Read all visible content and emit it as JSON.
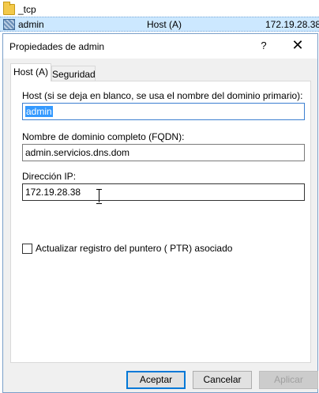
{
  "background_list": {
    "rows": [
      {
        "icon": "folder-icon",
        "name": "_tcp",
        "type": "",
        "data": ""
      },
      {
        "icon": "record-icon",
        "name": "admin",
        "type": "Host (A)",
        "data": "172.19.28.38"
      }
    ]
  },
  "dialog": {
    "title": "Propiedades de admin",
    "help_glyph": "?",
    "close_glyph": "✕",
    "tabs": [
      {
        "label": "Host (A)",
        "active": true
      },
      {
        "label": "Seguridad",
        "active": false
      }
    ],
    "host": {
      "label": "Host (si se deja en blanco, se usa el nombre del dominio primario):",
      "value": "admin"
    },
    "fqdn": {
      "label": "Nombre de dominio completo (FQDN):",
      "value": "admin.servicios.dns.dom"
    },
    "ip": {
      "label": "Dirección IP:",
      "value": "172.19.28.38"
    },
    "ptr_checkbox": {
      "label": "Actualizar registro del puntero ( PTR) asociado",
      "checked": false
    },
    "buttons": {
      "ok": "Aceptar",
      "cancel": "Cancelar",
      "apply": "Aplicar"
    }
  },
  "colors": {
    "selection": "#3399ff",
    "row_highlight": "#cce8ff",
    "focus_border": "#0078d7"
  }
}
